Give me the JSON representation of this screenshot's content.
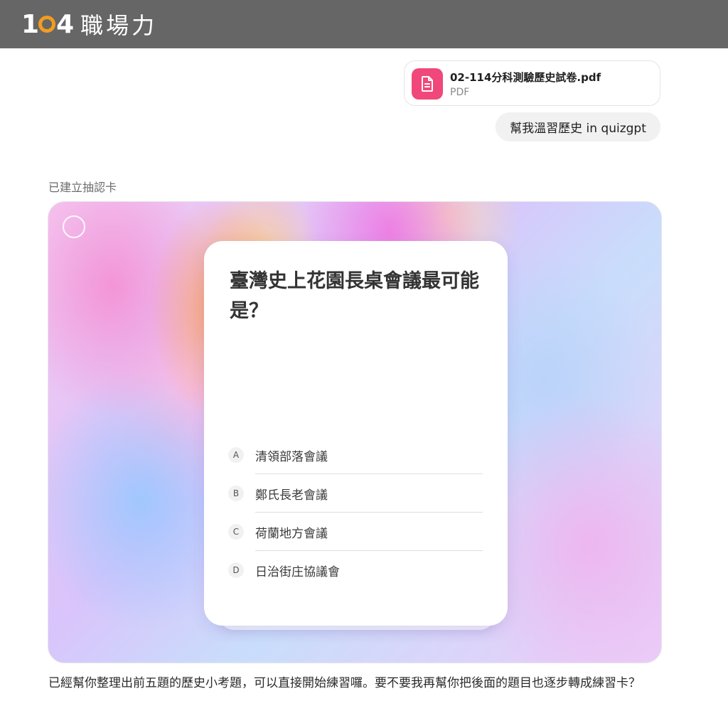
{
  "header": {
    "logo_number_left": "1",
    "logo_number_right": "4",
    "logo_text": "職場力"
  },
  "attachment": {
    "file_name": "02-114分科測驗歷史試卷.pdf",
    "file_type": "PDF",
    "icon": "document-icon",
    "icon_color": "#f0487a"
  },
  "user_message": {
    "text": "幫我溫習歷史 in quizgpt"
  },
  "assistant": {
    "status": "已建立抽認卡",
    "reply": "已經幫你整理出前五題的歷史小考題，可以直接開始練習囉。要不要我再幫你把後面的題目也逐步轉成練習卡？"
  },
  "quiz": {
    "question": "臺灣史上花園長桌會議最可能是？",
    "options": [
      {
        "letter": "A",
        "text": "清領部落會議"
      },
      {
        "letter": "B",
        "text": "鄭氏長老會議"
      },
      {
        "letter": "C",
        "text": "荷蘭地方會議"
      },
      {
        "letter": "D",
        "text": "日治街庄協議會"
      }
    ]
  }
}
